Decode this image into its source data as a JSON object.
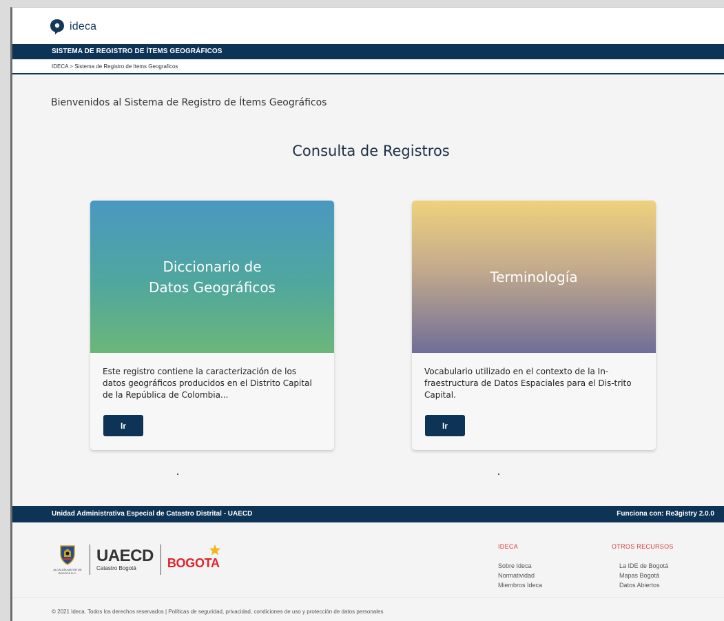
{
  "header": {
    "logo_text": "ideca",
    "system_title": "SISTEMA DE REGISTRO DE ÍTEMS GEOGRÁFICOS",
    "breadcrumb": "IDECA > Sistema de Registro de Items Geograficos"
  },
  "main": {
    "welcome": "Bienvenidos al Sistema de Registro de Ítems Geográficos",
    "title": "Consulta de Registros",
    "cards": [
      {
        "title": "Diccionario de\nDatos Geográficos",
        "description": "Este registro contiene la caracterización de los datos geográficos producidos en el Distrito Capital de la República de Colombia...",
        "button": "Ir"
      },
      {
        "title": "Terminología",
        "description": "Vocabulario utilizado en el contexto de la In-fraestructura de Datos Espaciales para el Dis-trito Capital.",
        "button": "Ir"
      }
    ]
  },
  "footer": {
    "org": "Unidad Administrativa Especial de Catastro Distrital - UAECD",
    "powered": "Funciona con: Re3gistry 2.0.0",
    "logos": {
      "alcaldia": "ALCALDÍA MAYOR DE BOGOTÁ D.C.",
      "uaecd": "UAECD",
      "uaecd_sub": "Catastro Bogotá",
      "bogota": "BOGOTA"
    },
    "columns": [
      {
        "title": "IDECA",
        "links": [
          "Sobre Ideca",
          "Normatividad",
          "Miembros Ideca"
        ]
      },
      {
        "title": "OTROS RECURSOS",
        "links": [
          "La IDE de Bogotá",
          "Mapas Bogotá",
          "Datos Abiertos"
        ]
      }
    ],
    "copyright": "© 2021 Ideca. Todos los derechos reservados | Políticas de seguridad, privacidad, condiciones de uso y protección de datos personales"
  },
  "colors": {
    "navy": "#0d3356",
    "accent_red": "#d93a3a",
    "card_left_gradient": [
      "#4a98c1",
      "#6cb67a"
    ],
    "card_right_gradient": [
      "#efd27d",
      "#706e98"
    ]
  }
}
